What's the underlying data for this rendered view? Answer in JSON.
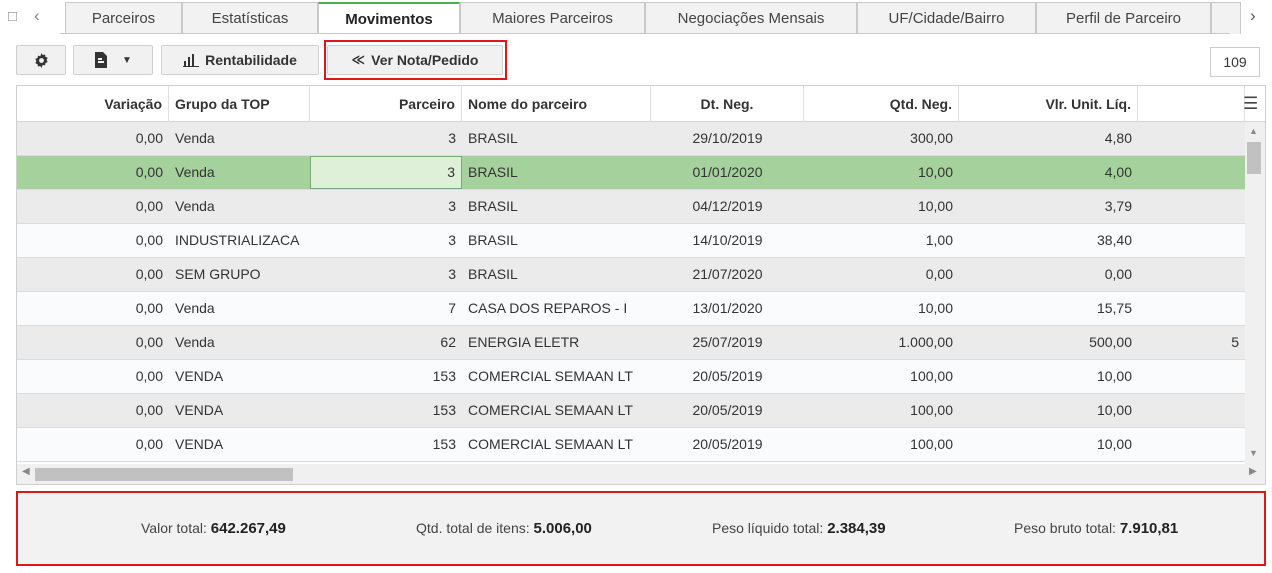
{
  "tabs": [
    "Parceiros",
    "Estatísticas",
    "Movimentos",
    "Maiores Parceiros",
    "Negociações Mensais",
    "UF/Cidade/Bairro",
    "Perfil de Parceiro"
  ],
  "active_tab": "Movimentos",
  "icons": {
    "tab_window": "window-icon",
    "tab_prev": "chevron-left-icon",
    "tab_next": "chevron-right-icon",
    "settings": "gear-icon",
    "export": "export-file-icon",
    "dropdown": "caret-down-icon",
    "rentabilidade": "bar-chart-icon",
    "ver_nota": "back-arrow-icon",
    "grid_menu": "hamburger-menu-icon"
  },
  "toolbar": {
    "rentabilidade_label": "Rentabilidade",
    "ver_nota_label": "Ver Nota/Pedido",
    "record_count": "109"
  },
  "grid": {
    "columns": [
      "Variação",
      "Grupo da TOP",
      "Parceiro",
      "Nome do parceiro",
      "Dt. Neg.",
      "Qtd. Neg.",
      "Vlr. Unit. Líq."
    ],
    "rows": [
      {
        "variacao": "0,00",
        "grupo": "Venda",
        "parceiro": "3",
        "nome": "BRASIL",
        "dt": "29/10/2019",
        "qtd": "300,00",
        "vlr": "4,80",
        "extra": ""
      },
      {
        "variacao": "0,00",
        "grupo": "Venda",
        "parceiro": "3",
        "nome": "BRASIL",
        "dt": "01/01/2020",
        "qtd": "10,00",
        "vlr": "4,00",
        "extra": ""
      },
      {
        "variacao": "0,00",
        "grupo": "Venda",
        "parceiro": "3",
        "nome": "BRASIL",
        "dt": "04/12/2019",
        "qtd": "10,00",
        "vlr": "3,79",
        "extra": ""
      },
      {
        "variacao": "0,00",
        "grupo": "INDUSTRIALIZACA",
        "parceiro": "3",
        "nome": "BRASIL",
        "dt": "14/10/2019",
        "qtd": "1,00",
        "vlr": "38,40",
        "extra": ""
      },
      {
        "variacao": "0,00",
        "grupo": "SEM GRUPO",
        "parceiro": "3",
        "nome": "BRASIL",
        "dt": "21/07/2020",
        "qtd": "0,00",
        "vlr": "0,00",
        "extra": ""
      },
      {
        "variacao": "0,00",
        "grupo": "Venda",
        "parceiro": "7",
        "nome": "CASA DOS REPAROS - I",
        "dt": "13/01/2020",
        "qtd": "10,00",
        "vlr": "15,75",
        "extra": ""
      },
      {
        "variacao": "0,00",
        "grupo": "Venda",
        "parceiro": "62",
        "nome": "ENERGIA ELETR",
        "dt": "25/07/2019",
        "qtd": "1.000,00",
        "vlr": "500,00",
        "extra": "5"
      },
      {
        "variacao": "0,00",
        "grupo": "VENDA",
        "parceiro": "153",
        "nome": "COMERCIAL SEMAAN LT",
        "dt": "20/05/2019",
        "qtd": "100,00",
        "vlr": "10,00",
        "extra": ""
      },
      {
        "variacao": "0,00",
        "grupo": "VENDA",
        "parceiro": "153",
        "nome": "COMERCIAL SEMAAN LT",
        "dt": "20/05/2019",
        "qtd": "100,00",
        "vlr": "10,00",
        "extra": ""
      },
      {
        "variacao": "0,00",
        "grupo": "VENDA",
        "parceiro": "153",
        "nome": "COMERCIAL SEMAAN LT",
        "dt": "20/05/2019",
        "qtd": "100,00",
        "vlr": "10,00",
        "extra": ""
      }
    ]
  },
  "summary": {
    "valor_total_label": "Valor total:",
    "valor_total": "642.267,49",
    "qtd_total_label": "Qtd. total de itens:",
    "qtd_total": "5.006,00",
    "peso_liquido_label": "Peso líquido total:",
    "peso_liquido": "2.384,39",
    "peso_bruto_label": "Peso bruto total:",
    "peso_bruto": "7.910,81"
  },
  "colors": {
    "accent_green": "#4caf50",
    "selected_row": "#a5d19d",
    "highlight_red": "#e0161b"
  }
}
